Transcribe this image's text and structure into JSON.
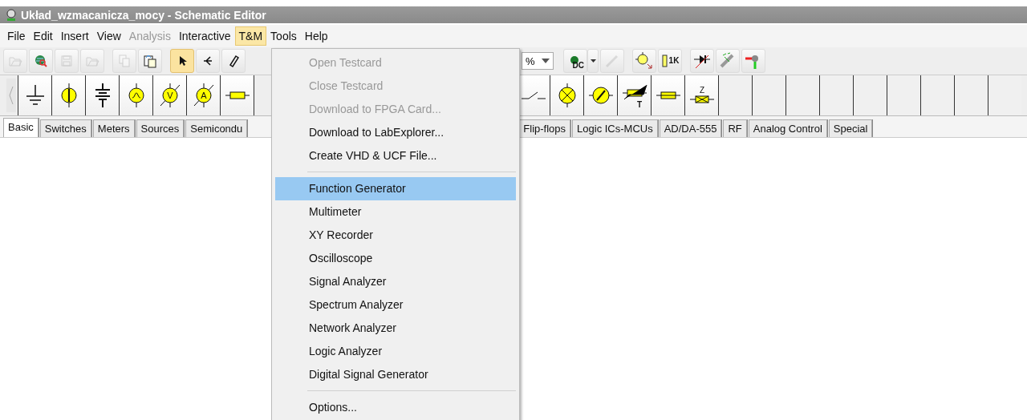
{
  "window": {
    "title": "Układ_wzmacanicza_mocy - Schematic Editor"
  },
  "menu_bar": [
    {
      "label": "File",
      "disabled": false,
      "selected": false
    },
    {
      "label": "Edit",
      "disabled": false,
      "selected": false
    },
    {
      "label": "Insert",
      "disabled": false,
      "selected": false
    },
    {
      "label": "View",
      "disabled": false,
      "selected": false
    },
    {
      "label": "Analysis",
      "disabled": true,
      "selected": false
    },
    {
      "label": "Interactive",
      "disabled": false,
      "selected": false
    },
    {
      "label": "T&M",
      "disabled": false,
      "selected": true
    },
    {
      "label": "Tools",
      "disabled": false,
      "selected": false
    },
    {
      "label": "Help",
      "disabled": false,
      "selected": false
    }
  ],
  "toolbar_left": [
    {
      "kind": "open",
      "disabled": true,
      "selected": false
    },
    {
      "kind": "globe",
      "disabled": false,
      "selected": false
    },
    {
      "kind": "save",
      "disabled": true,
      "selected": false
    },
    {
      "kind": "open",
      "disabled": true,
      "selected": false
    },
    {
      "kind": "copy",
      "disabled": true,
      "selected": false
    },
    {
      "kind": "paste",
      "disabled": false,
      "selected": false
    },
    {
      "kind": "pointer",
      "disabled": false,
      "selected": true
    },
    {
      "kind": "wire",
      "disabled": false,
      "selected": false
    },
    {
      "kind": "pencil",
      "disabled": false,
      "selected": false
    }
  ],
  "zoom_combo": {
    "value": "%"
  },
  "toolbar_right": [
    {
      "kind": "dc",
      "label": "DC",
      "disabled": false
    },
    {
      "kind": "probe",
      "disabled": true
    },
    {
      "kind": "voltprobe",
      "disabled": false
    },
    {
      "kind": "res1k",
      "label": "1K",
      "disabled": false
    },
    {
      "kind": "diode",
      "disabled": false
    },
    {
      "kind": "led",
      "disabled": false
    },
    {
      "kind": "pin",
      "disabled": false
    }
  ],
  "palette_left": [
    {
      "kind": "ground"
    },
    {
      "kind": "current"
    },
    {
      "kind": "battery"
    },
    {
      "kind": "ac"
    },
    {
      "kind": "voltmeter",
      "label": "V"
    },
    {
      "kind": "ammeter",
      "label": "A"
    },
    {
      "kind": "resistor"
    }
  ],
  "palette_right": [
    {
      "kind": "switch"
    },
    {
      "kind": "lamp"
    },
    {
      "kind": "motor"
    },
    {
      "kind": "thermistor",
      "label": "T"
    },
    {
      "kind": "fuse"
    },
    {
      "kind": "crystal",
      "label": "Z"
    },
    {
      "kind": "empty"
    },
    {
      "kind": "empty"
    },
    {
      "kind": "empty"
    },
    {
      "kind": "empty"
    },
    {
      "kind": "empty"
    },
    {
      "kind": "empty"
    },
    {
      "kind": "empty"
    },
    {
      "kind": "empty"
    },
    {
      "kind": "empty"
    }
  ],
  "tabs_left": [
    {
      "label": "Basic",
      "selected": true
    },
    {
      "label": "Switches",
      "selected": false
    },
    {
      "label": "Meters",
      "selected": false
    },
    {
      "label": "Sources",
      "selected": false
    },
    {
      "label": "Semicondu",
      "selected": false
    }
  ],
  "tabs_right": [
    {
      "label": "Flip-flops",
      "selected": false
    },
    {
      "label": "Logic ICs-MCUs",
      "selected": false
    },
    {
      "label": "AD/DA-555",
      "selected": false
    },
    {
      "label": "RF",
      "selected": false
    },
    {
      "label": "Analog Control",
      "selected": false
    },
    {
      "label": "Special",
      "selected": false
    }
  ],
  "dropdown": [
    {
      "kind": "item",
      "label": "Open Testcard",
      "disabled": true,
      "selected": false
    },
    {
      "kind": "item",
      "label": "Close Testcard",
      "disabled": true,
      "selected": false
    },
    {
      "kind": "item",
      "label": "Download to FPGA Card...",
      "disabled": true,
      "selected": false
    },
    {
      "kind": "item",
      "label": "Download to LabExplorer...",
      "disabled": false,
      "selected": false
    },
    {
      "kind": "item",
      "label": "Create VHD & UCF File...",
      "disabled": false,
      "selected": false
    },
    {
      "kind": "separator"
    },
    {
      "kind": "item",
      "label": "Function Generator",
      "disabled": false,
      "selected": true
    },
    {
      "kind": "item",
      "label": "Multimeter",
      "disabled": false,
      "selected": false
    },
    {
      "kind": "item",
      "label": "XY Recorder",
      "disabled": false,
      "selected": false
    },
    {
      "kind": "item",
      "label": "Oscilloscope",
      "disabled": false,
      "selected": false
    },
    {
      "kind": "item",
      "label": "Signal Analyzer",
      "disabled": false,
      "selected": false
    },
    {
      "kind": "item",
      "label": "Spectrum Analyzer",
      "disabled": false,
      "selected": false
    },
    {
      "kind": "item",
      "label": "Network Analyzer",
      "disabled": false,
      "selected": false
    },
    {
      "kind": "item",
      "label": "Logic Analyzer",
      "disabled": false,
      "selected": false
    },
    {
      "kind": "item",
      "label": "Digital Signal Generator",
      "disabled": false,
      "selected": false
    },
    {
      "kind": "separator"
    },
    {
      "kind": "item",
      "label": "Options...",
      "disabled": false,
      "selected": false
    }
  ]
}
